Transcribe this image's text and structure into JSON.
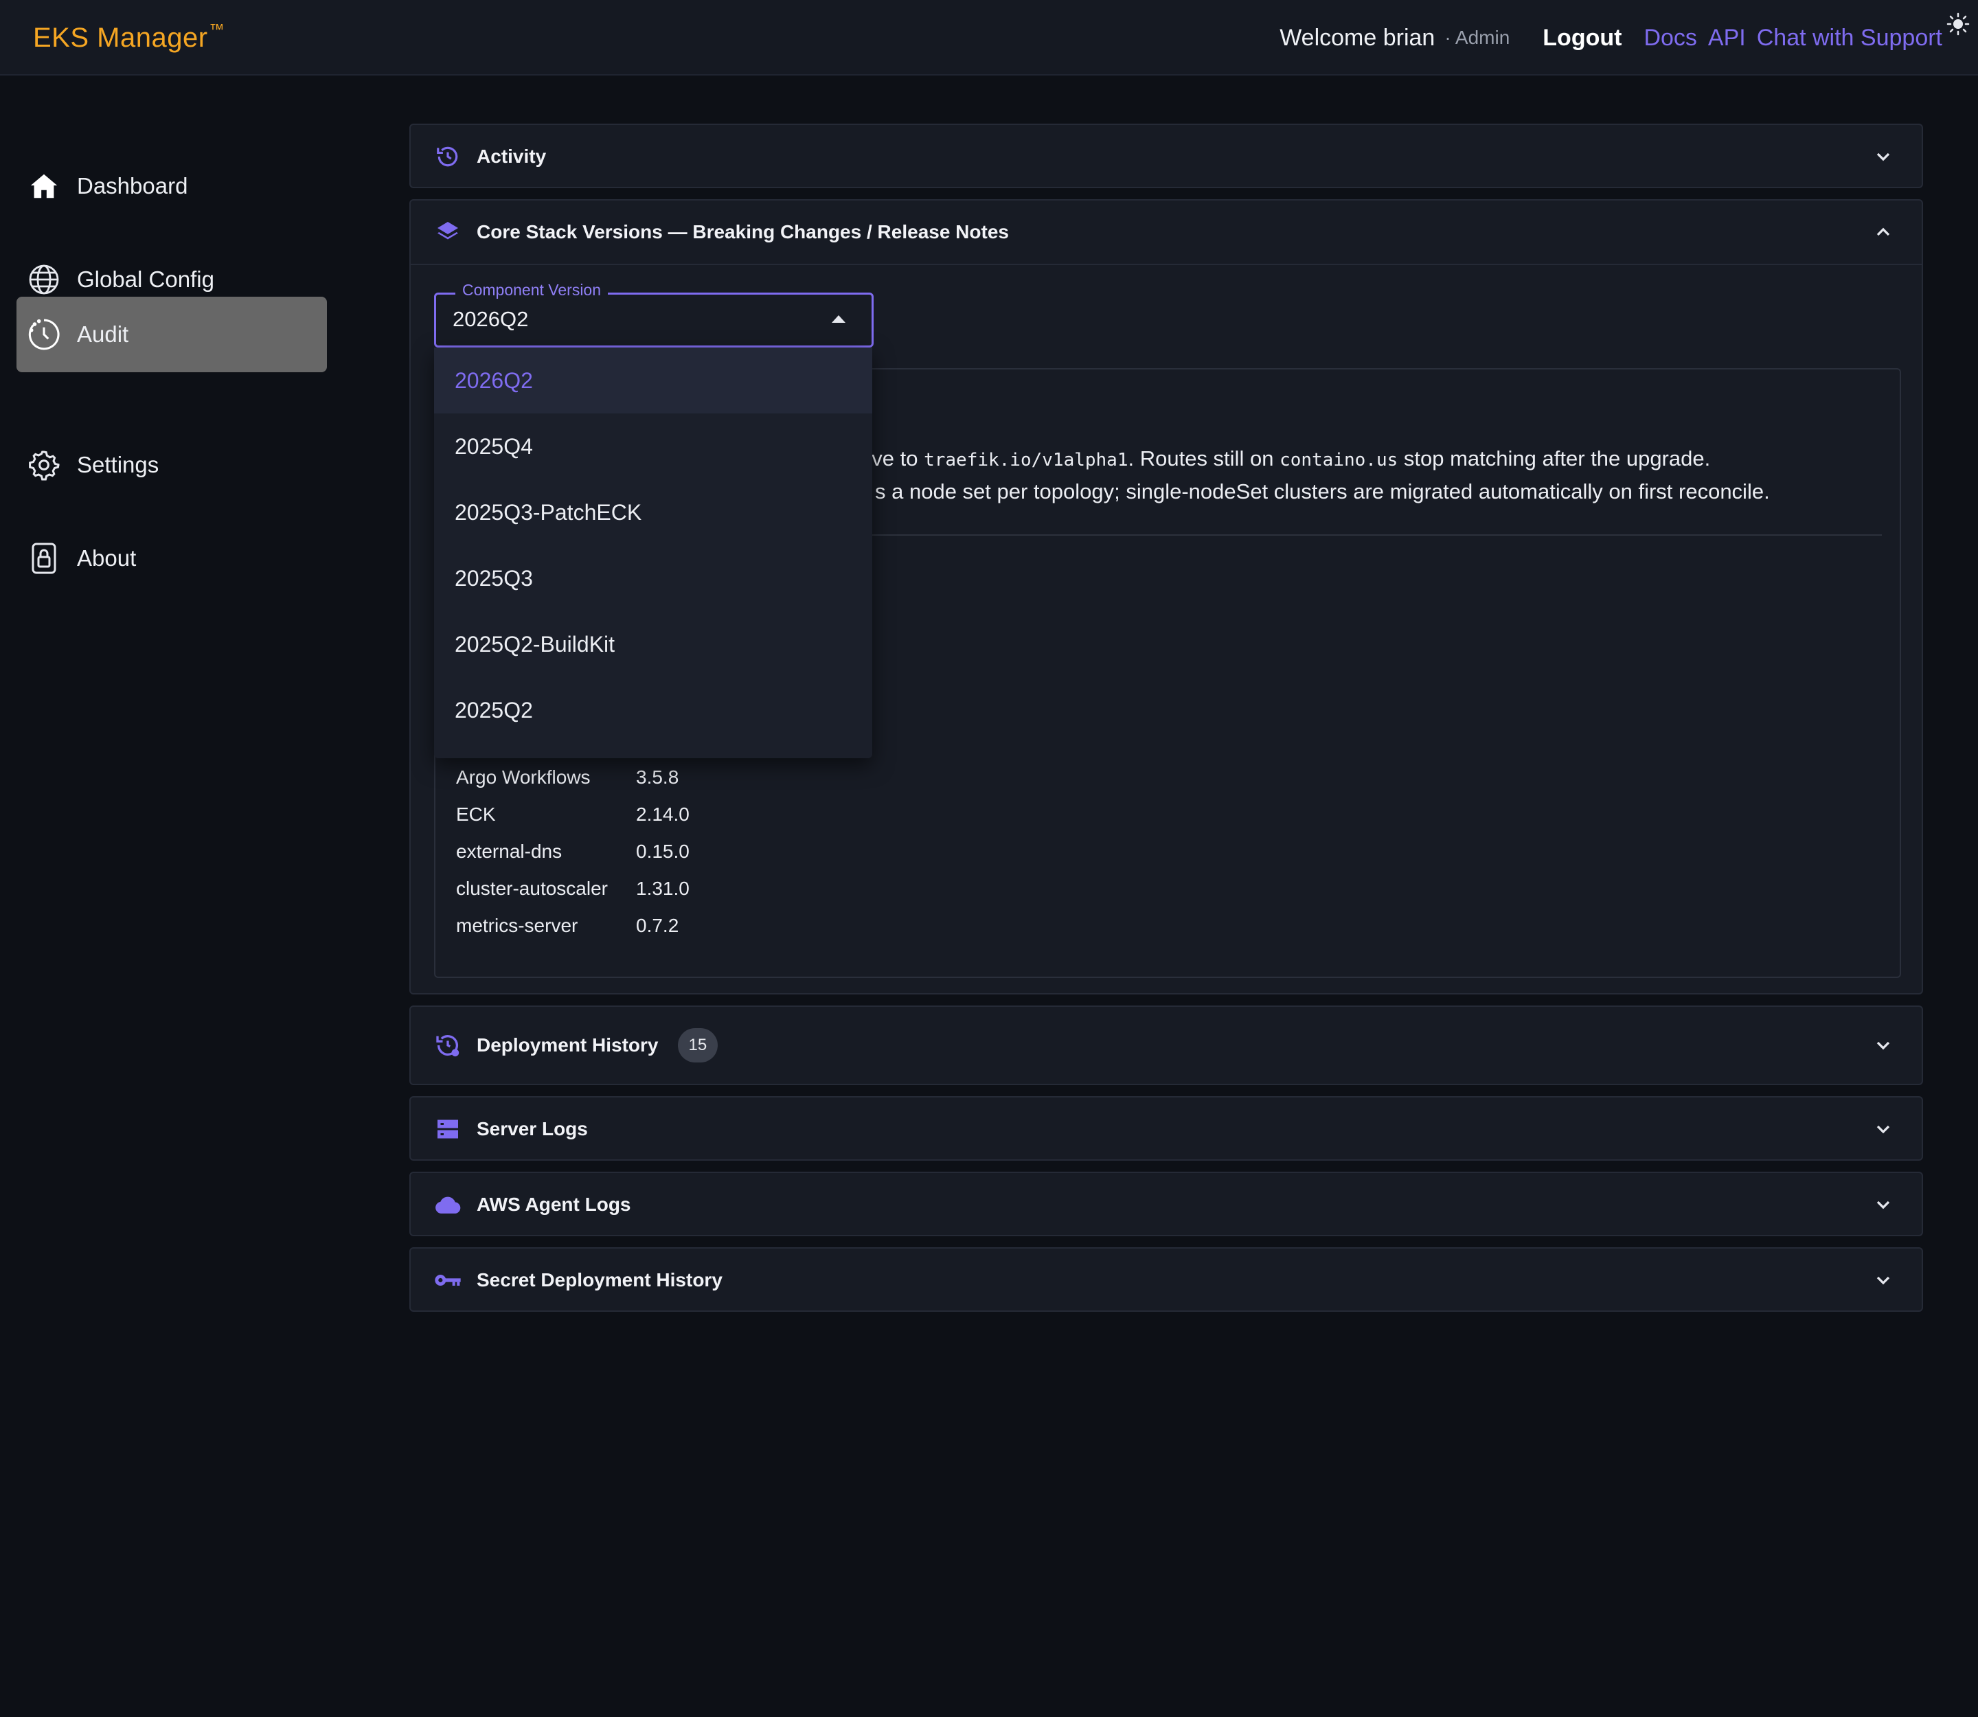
{
  "header": {
    "brand": "EKS Manager",
    "brand_mark": "™",
    "welcome": "Welcome brian",
    "role": "· Admin",
    "logout": "Logout",
    "links": [
      "Docs",
      "API",
      "Chat with Support"
    ]
  },
  "sidebar": {
    "items": [
      {
        "label": "Dashboard",
        "icon": "home-icon"
      },
      {
        "label": "Global Config",
        "icon": "globe-icon"
      },
      {
        "label": "Audit",
        "icon": "clock-icon",
        "active": true
      },
      {
        "label": "Settings",
        "icon": "gear-icon"
      },
      {
        "label": "About",
        "icon": "lock-icon"
      }
    ]
  },
  "panels": {
    "activity": {
      "title": "Activity"
    },
    "core_stack": {
      "title": "Core Stack Versions — Breaking Changes / Release Notes",
      "select": {
        "legend": "Component Version",
        "value": "2026Q2"
      },
      "notes": {
        "line1_prefix": "ove to",
        "line1_code1": "traefik.io/v1alpha1",
        "line1_mid": ". Routes still on",
        "line1_code2": "containo.us",
        "line1_suffix": "stop matching after the upgrade.",
        "line2": "s a node set per topology; single-nodeSet clusters are migrated automatically on first reconcile."
      },
      "versions": [
        {
          "name": "Argo Workflows",
          "version": "3.5.8"
        },
        {
          "name": "ECK",
          "version": "2.14.0"
        },
        {
          "name": "external-dns",
          "version": "0.15.0"
        },
        {
          "name": "cluster-autoscaler",
          "version": "1.31.0"
        },
        {
          "name": "metrics-server",
          "version": "0.7.2"
        }
      ]
    },
    "deployment_history": {
      "title": "Deployment History",
      "count": "15"
    },
    "server_logs": {
      "title": "Server Logs"
    },
    "aws_agent_logs": {
      "title": "AWS Agent Logs"
    },
    "secret_deployment_history": {
      "title": "Secret Deployment History"
    }
  },
  "dropdown": {
    "options": [
      "2026Q2",
      "2025Q4",
      "2025Q3-PatchECK",
      "2025Q3",
      "2025Q2-BuildKit",
      "2025Q2"
    ],
    "selected_index": 0
  },
  "colors": {
    "accent": "#7f6cf0",
    "brand": "#f5a623",
    "active_nav": "#676767"
  }
}
